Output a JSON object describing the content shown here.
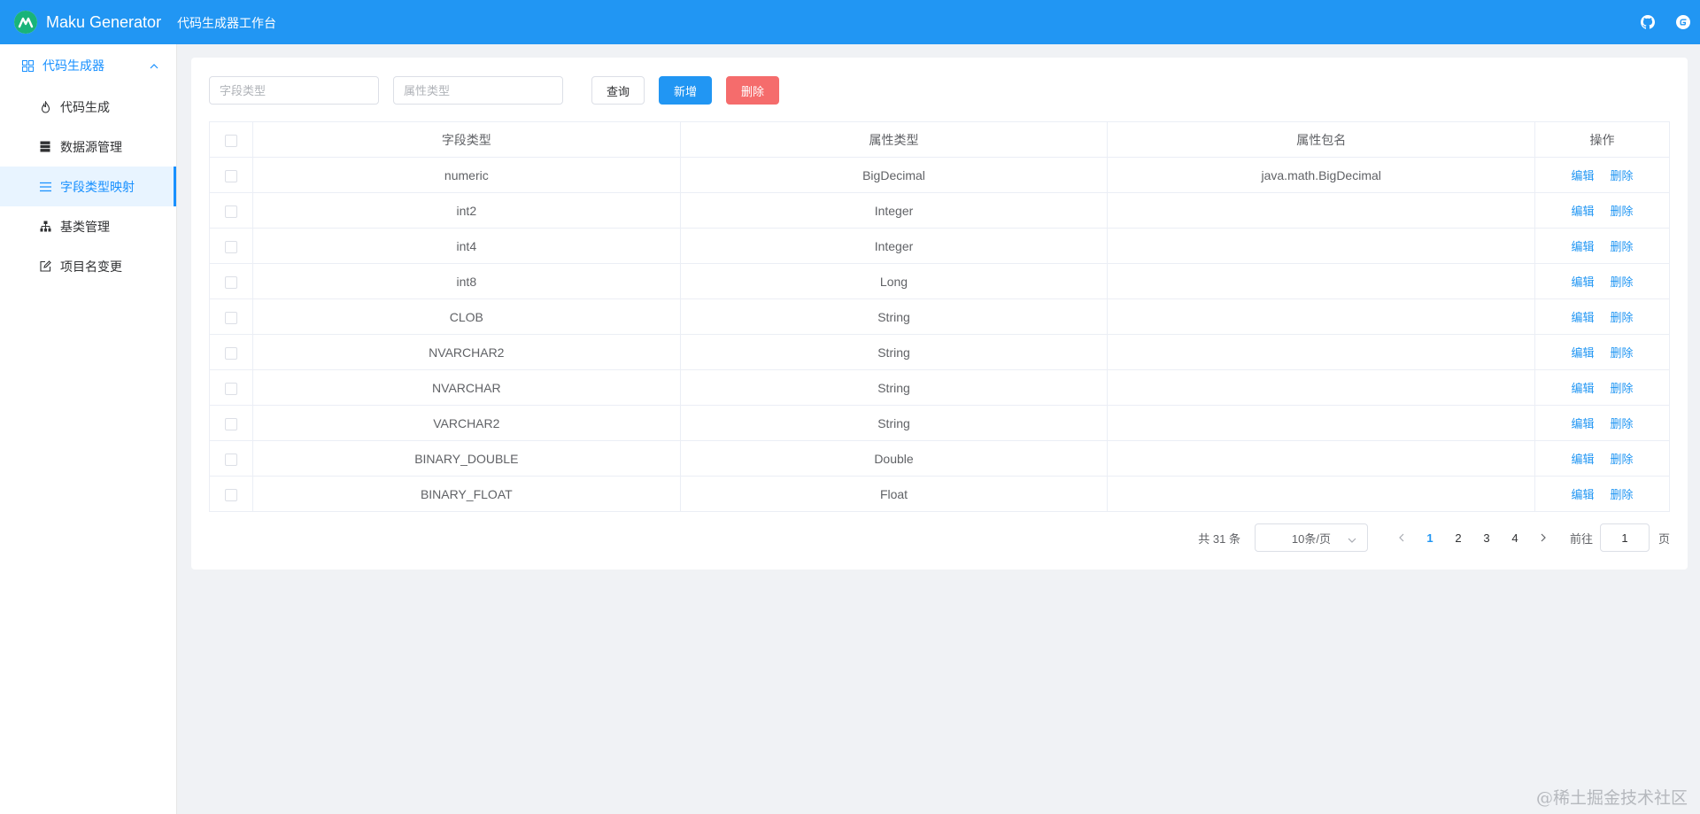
{
  "header": {
    "app_title": "Maku Generator",
    "subtitle": "代码生成器工作台",
    "icons": [
      "github-icon",
      "gitee-icon"
    ]
  },
  "sidebar": {
    "group_label": "代码生成器",
    "items": [
      {
        "label": "代码生成",
        "icon": "fire-icon",
        "active": false
      },
      {
        "label": "数据源管理",
        "icon": "database-icon",
        "active": false
      },
      {
        "label": "字段类型映射",
        "icon": "list-icon",
        "active": true
      },
      {
        "label": "基类管理",
        "icon": "hierarchy-icon",
        "active": false
      },
      {
        "label": "项目名变更",
        "icon": "edit-icon",
        "active": false
      }
    ]
  },
  "search": {
    "column_type_placeholder": "字段类型",
    "attr_type_placeholder": "属性类型",
    "query_label": "查询",
    "add_label": "新增",
    "delete_label": "删除"
  },
  "table": {
    "headers": [
      "字段类型",
      "属性类型",
      "属性包名",
      "操作"
    ],
    "rows": [
      {
        "column_type": "numeric",
        "attr_type": "BigDecimal",
        "package": "java.math.BigDecimal"
      },
      {
        "column_type": "int2",
        "attr_type": "Integer",
        "package": ""
      },
      {
        "column_type": "int4",
        "attr_type": "Integer",
        "package": ""
      },
      {
        "column_type": "int8",
        "attr_type": "Long",
        "package": ""
      },
      {
        "column_type": "CLOB",
        "attr_type": "String",
        "package": ""
      },
      {
        "column_type": "NVARCHAR2",
        "attr_type": "String",
        "package": ""
      },
      {
        "column_type": "NVARCHAR",
        "attr_type": "String",
        "package": ""
      },
      {
        "column_type": "VARCHAR2",
        "attr_type": "String",
        "package": ""
      },
      {
        "column_type": "BINARY_DOUBLE",
        "attr_type": "Double",
        "package": ""
      },
      {
        "column_type": "BINARY_FLOAT",
        "attr_type": "Float",
        "package": ""
      }
    ],
    "edit_label": "编辑",
    "delete_label": "删除"
  },
  "pagination": {
    "total": "共 31 条",
    "page_size": "10条/页",
    "pages": [
      "1",
      "2",
      "3",
      "4"
    ],
    "current_page": "1",
    "goto_label": "前往",
    "goto_value": "1",
    "goto_suffix": "页"
  },
  "watermark": "@稀土掘金技术社区",
  "colors": {
    "primary": "#2196f3",
    "danger": "#f56c6c",
    "sidebar_active_bg": "#e8f4ff",
    "logo_green": "#19b37a"
  }
}
